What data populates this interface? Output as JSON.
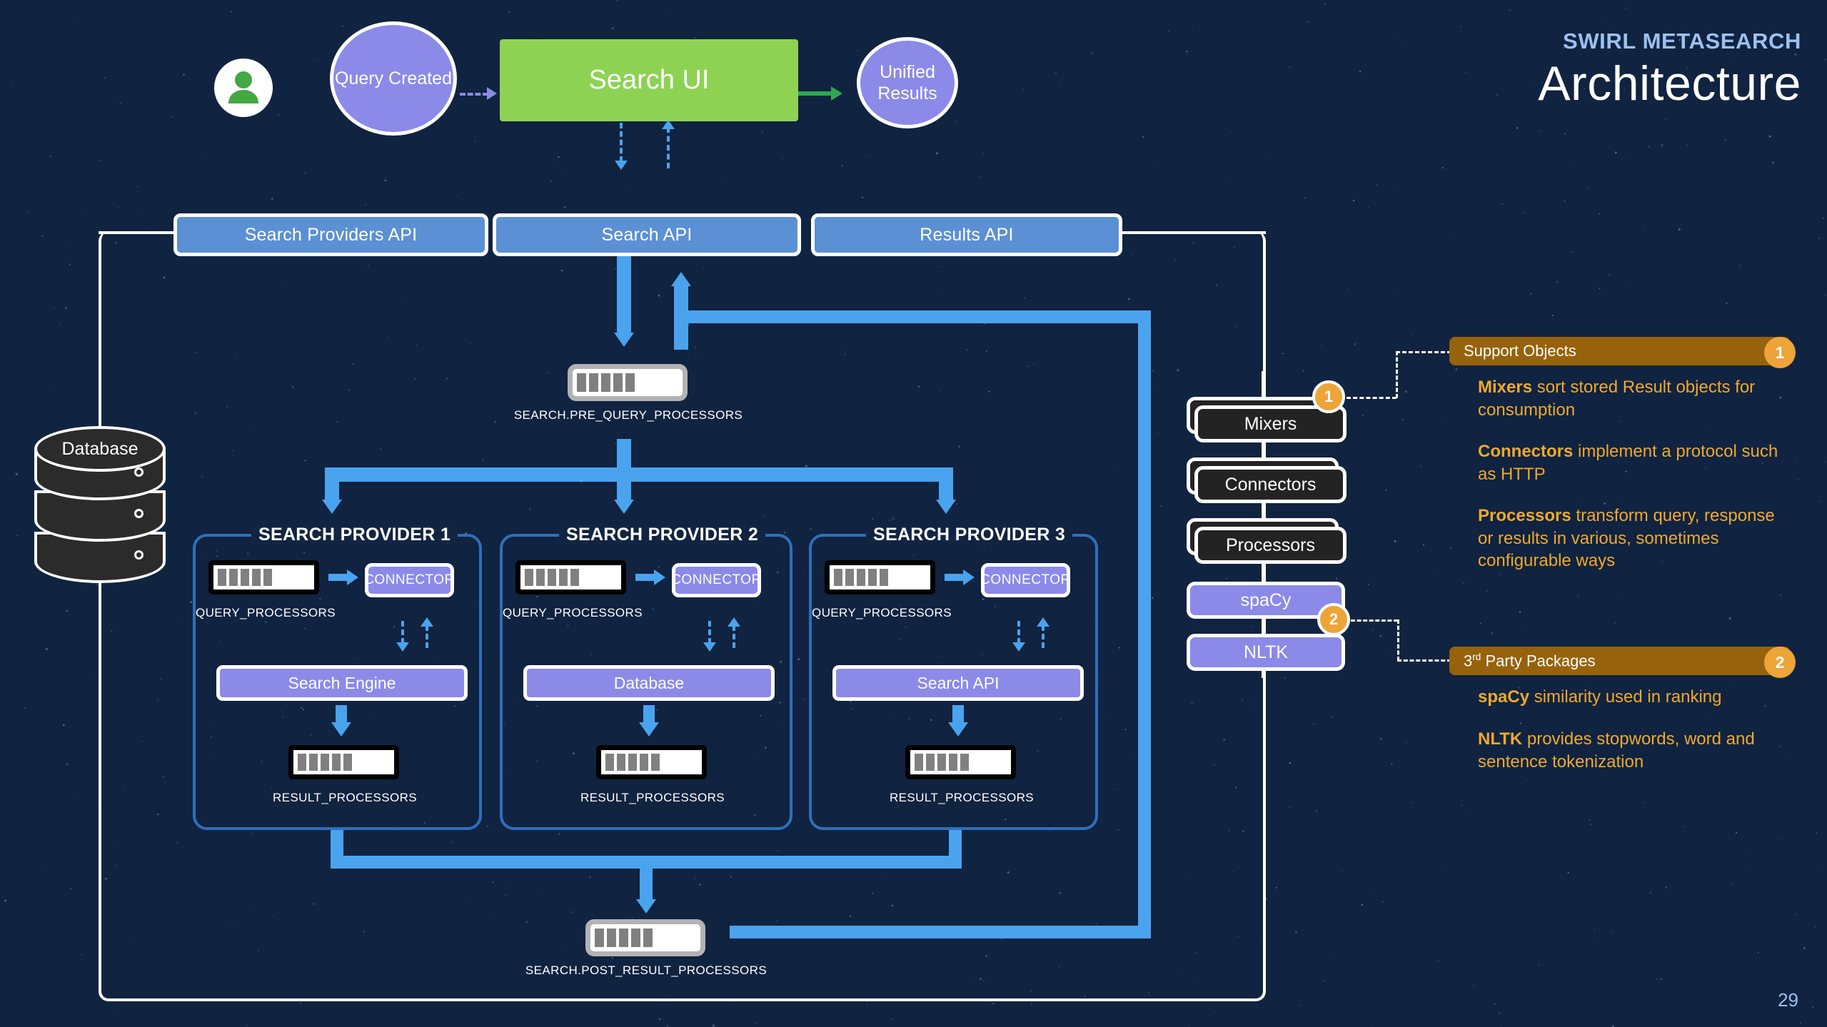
{
  "page": {
    "kicker": "SWIRL METASEARCH",
    "title": "Architecture",
    "page_number": "29",
    "background_color": "#102340",
    "accent_blue": "#4aa3ef",
    "accent_green": "#8ed254",
    "accent_purple": "#8b8ae8",
    "accent_orange": "#eda438",
    "accent_amber_text": "#f0a92c"
  },
  "top_flow": {
    "user_icon": "user-avatar-icon",
    "query_created": "Query Created",
    "search_ui": "Search UI",
    "unified_results": "Unified Results"
  },
  "api_bar": {
    "items": [
      {
        "label": "Search Providers API"
      },
      {
        "label": "Search API"
      },
      {
        "label": "Results API"
      }
    ]
  },
  "database": {
    "label": "Database",
    "tiers": 3
  },
  "pre_query": {
    "label": "SEARCH.PRE_QUERY_PROCESSORS",
    "bars": 5
  },
  "post_result": {
    "label": "SEARCH.POST_RESULT_PROCESSORS",
    "bars": 5
  },
  "providers": [
    {
      "title": "SEARCH PROVIDER 1",
      "query_processors_label": "QUERY_PROCESSORS",
      "connector_label": "CONNECTOR",
      "backend_label": "Search Engine",
      "result_processors_label": "RESULT_PROCESSORS",
      "bars": 5
    },
    {
      "title": "SEARCH PROVIDER 2",
      "query_processors_label": "QUERY_PROCESSORS",
      "connector_label": "CONNECTOR",
      "backend_label": "Database",
      "result_processors_label": "RESULT_PROCESSORS",
      "bars": 5
    },
    {
      "title": "SEARCH PROVIDER 3",
      "query_processors_label": "QUERY_PROCESSORS",
      "connector_label": "CONNECTOR",
      "backend_label": "Search API",
      "result_processors_label": "RESULT_PROCESSORS",
      "bars": 5
    }
  ],
  "component_stack": [
    {
      "label": "Mixers",
      "style": "dark",
      "stacked": true
    },
    {
      "label": "Connectors",
      "style": "dark",
      "stacked": true
    },
    {
      "label": "Processors",
      "style": "dark",
      "stacked": true
    },
    {
      "label": "spaCy",
      "style": "purple",
      "stacked": false
    },
    {
      "label": "NLTK",
      "style": "purple",
      "stacked": false
    }
  ],
  "badges": {
    "one": "1",
    "two": "2"
  },
  "legend": [
    {
      "header": "Support Objects",
      "badge": "1",
      "items": [
        {
          "term": "Mixers",
          "text": " sort stored Result objects for consumption"
        },
        {
          "term": "Connectors",
          "text": " implement a protocol such as HTTP"
        },
        {
          "term": "Processors",
          "text": " transform query, response or results in various, sometimes configurable ways"
        }
      ]
    },
    {
      "header_prefix": "3",
      "header_sup": "rd",
      "header_suffix": " Party Packages",
      "badge": "2",
      "items": [
        {
          "term": "spaCy",
          "text": " similarity used in ranking"
        },
        {
          "term": "NLTK",
          "text": " provides stopwords, word and sentence tokenization"
        }
      ]
    }
  ]
}
